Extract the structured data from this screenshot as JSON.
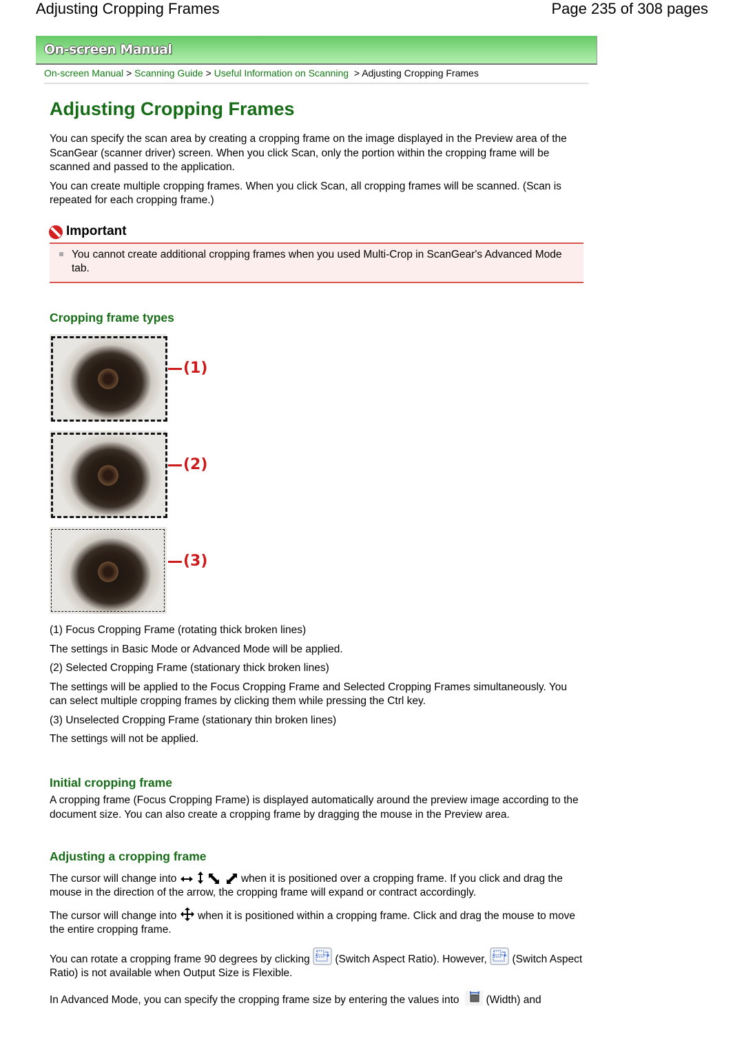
{
  "header": {
    "doc_title": "Adjusting Cropping Frames",
    "page_indicator": "Page 235 of 308 pages"
  },
  "banner": {
    "title": "On-screen Manual"
  },
  "breadcrumb": {
    "items": [
      "On-screen Manual",
      "Scanning Guide",
      "Useful Information on Scanning"
    ],
    "separator": ">",
    "current": "Adjusting Cropping Frames"
  },
  "main": {
    "title": "Adjusting Cropping Frames",
    "intro": [
      "You can specify the scan area by creating a cropping frame on the image displayed in the Preview area of the ScanGear (scanner driver) screen. When you click Scan, only the portion within the cropping frame will be scanned and passed to the application.",
      "You can create multiple cropping frames. When you click Scan, all cropping frames will be scanned. (Scan is repeated for each cropping frame.)"
    ],
    "important": {
      "heading": "Important",
      "items": [
        "You cannot create additional cropping frames when you used Multi-Crop in ScanGear's Advanced Mode tab."
      ]
    },
    "types": {
      "heading": "Cropping frame types",
      "figure_labels": [
        "(1)",
        "(2)",
        "(3)"
      ],
      "descriptions": [
        "(1) Focus Cropping Frame (rotating thick broken lines)",
        "The settings in Basic Mode or Advanced Mode will be applied.",
        "(2) Selected Cropping Frame (stationary thick broken lines)",
        "The settings will be applied to the Focus Cropping Frame and Selected Cropping Frames simultaneously. You can select multiple cropping frames by clicking them while pressing the Ctrl key.",
        "(3) Unselected Cropping Frame (stationary thin broken lines)",
        "The settings will not be applied."
      ]
    },
    "initial": {
      "heading": "Initial cropping frame",
      "text": "A cropping frame (Focus Cropping Frame) is displayed automatically around the preview image according to the document size. You can also create a cropping frame by dragging the mouse in the Preview area."
    },
    "adjusting": {
      "heading": "Adjusting a cropping frame",
      "p1_before": "The cursor will change into",
      "p1_after": "when it is positioned over a cropping frame. If you click and drag the mouse in the direction of the arrow, the cropping frame will expand or contract accordingly.",
      "p2_before": "The cursor will change into",
      "p2_after": "when it is positioned within a cropping frame. Click and drag the mouse to move the entire cropping frame.",
      "p3_before": "You can rotate a cropping frame 90 degrees by clicking",
      "p3_mid": "(Switch Aspect Ratio). However,",
      "p3_after": "(Switch Aspect Ratio) is not available when Output Size is Flexible.",
      "p4_before": "In Advanced Mode, you can specify the cropping frame size by entering the values into",
      "p4_after": "(Width) and"
    }
  }
}
